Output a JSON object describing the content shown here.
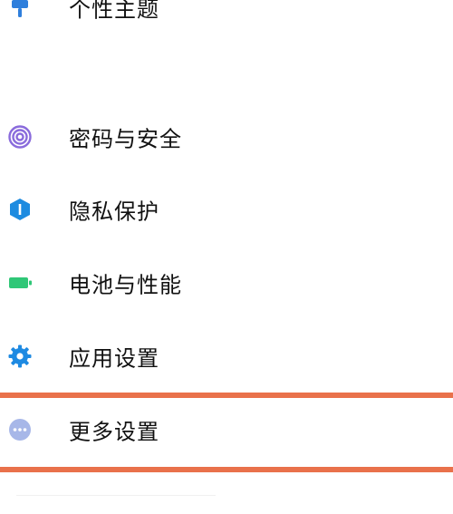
{
  "settings": {
    "items": [
      {
        "label": "个性主题",
        "icon": "theme-brush-icon",
        "color": "#2f7fdc"
      },
      {
        "label": "密码与安全",
        "icon": "fingerprint-icon",
        "color": "#8a6bdc"
      },
      {
        "label": "隐私保护",
        "icon": "privacy-shield-icon",
        "color": "#1d8be0"
      },
      {
        "label": "电池与性能",
        "icon": "battery-icon",
        "color": "#2fc777"
      },
      {
        "label": "应用设置",
        "icon": "gear-icon",
        "color": "#1e8ae2"
      },
      {
        "label": "更多设置",
        "icon": "more-dots-icon",
        "color": "#a7b7e8"
      }
    ]
  },
  "highlight_color": "#e9714b"
}
